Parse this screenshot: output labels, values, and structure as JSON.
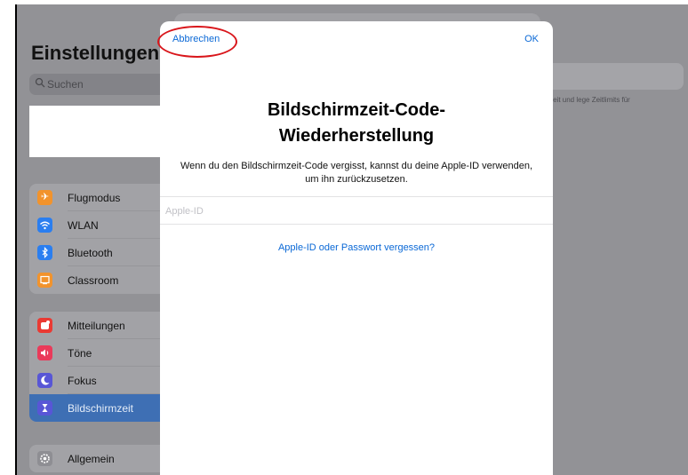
{
  "settings": {
    "title": "Einstellungen",
    "search_placeholder": "Suchen",
    "groups": [
      [
        {
          "label": "Flugmodus",
          "icon": "airplane-icon",
          "color": "#f2932c"
        },
        {
          "label": "WLAN",
          "icon": "wifi-icon",
          "color": "#2a7ef0"
        },
        {
          "label": "Bluetooth",
          "icon": "bluetooth-icon",
          "color": "#2a7ef0"
        },
        {
          "label": "Classroom",
          "icon": "classroom-icon",
          "color": "#f2932c"
        }
      ],
      [
        {
          "label": "Mitteilungen",
          "icon": "notifications-icon",
          "color": "#ea3a33"
        },
        {
          "label": "Töne",
          "icon": "sounds-icon",
          "color": "#ea3a5a"
        },
        {
          "label": "Fokus",
          "icon": "moon-icon",
          "color": "#5856d6"
        },
        {
          "label": "Bildschirmzeit",
          "icon": "hourglass-icon",
          "color": "#5856d6",
          "selected": true
        }
      ],
      [
        {
          "label": "Allgemein",
          "icon": "gear-icon",
          "color": "#8e8e93"
        }
      ]
    ],
    "right_text": "irmzeit und lege Zeitlimits für"
  },
  "modal": {
    "cancel_label": "Abbrechen",
    "ok_label": "OK",
    "title": "Bildschirmzeit-Code-Wiederherstellung",
    "description": "Wenn du den Bildschirmzeit-Code vergisst, kannst du deine Apple-ID verwenden, um ihn zurückzusetzen.",
    "apple_id_placeholder": "Apple-ID",
    "apple_id_value": "",
    "forgot_link": "Apple-ID oder Passwort vergessen?"
  },
  "colors": {
    "accent": "#0a68d6",
    "highlight_circle": "#d9161b",
    "selected_row": "#3e6fb4"
  }
}
